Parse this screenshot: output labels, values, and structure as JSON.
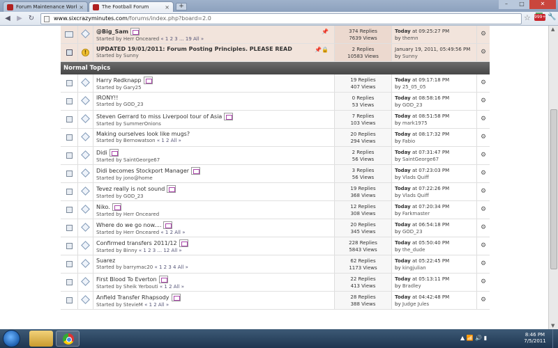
{
  "browser": {
    "tabs": [
      {
        "label": "Forum Maintenance Work",
        "active": false
      },
      {
        "label": "The Football Forum",
        "active": true
      }
    ],
    "new_tab_label": "+",
    "url_host": "www.sixcrazyminutes.com",
    "url_path": "/forums/index.php?board=2.0",
    "extension_badge": "999+"
  },
  "sticky_topics": [
    {
      "subject": "@Big_Sam",
      "started_by": "Herr Onceared",
      "pages": "« 1 2 3 ... 19  All »",
      "replies": "374 Replies",
      "views": "7639 Views",
      "last_time_prefix": "Today",
      "last_time": " at 09:25:27 PM",
      "last_by": "themn",
      "icon": "hot"
    },
    {
      "subject": "UPDATED 19/01/2011: Forum Posting Principles. PLEASE READ",
      "started_by": "Sunny",
      "pages": "",
      "replies": "2 Replies",
      "views": "10583 Views",
      "last_time_prefix": "",
      "last_time": "January 19, 2011, 05:49:56 PM",
      "last_by": "Sunny",
      "icon": "locked"
    }
  ],
  "section_title": "Normal Topics",
  "topics": [
    {
      "subject": "Harry Redknapp",
      "new": true,
      "started_by": "Gary25",
      "pages": "",
      "replies": "19 Replies",
      "views": "407 Views",
      "last_time": " at 09:17:18 PM",
      "last_by": "25_05_05"
    },
    {
      "subject": "IRONY!!",
      "new": false,
      "started_by": "GOD_23",
      "pages": "",
      "replies": "0 Replies",
      "views": "53 Views",
      "last_time": " at 08:58:16 PM",
      "last_by": "GOD_23"
    },
    {
      "subject": "Steven Gerrard to miss Liverpool tour of Asia",
      "new": true,
      "started_by": "SummerOnions",
      "pages": "",
      "replies": "7 Replies",
      "views": "103 Views",
      "last_time": " at 08:51:58 PM",
      "last_by": "mark1975"
    },
    {
      "subject": "Making ourselves look like mugs?",
      "new": false,
      "started_by": "Bernowatson",
      "pages": "« 1 2  All »",
      "replies": "20 Replies",
      "views": "294 Views",
      "last_time": " at 08:17:32 PM",
      "last_by": "Fabio"
    },
    {
      "subject": "Didi",
      "new": true,
      "started_by": "SaintGeorge67",
      "pages": "",
      "replies": "2 Replies",
      "views": "56 Views",
      "last_time": " at 07:31:47 PM",
      "last_by": "SaintGeorge67"
    },
    {
      "subject": "Didi becomes Stockport Manager",
      "new": true,
      "started_by": "jono@home",
      "pages": "",
      "replies": "3 Replies",
      "views": "56 Views",
      "last_time": " at 07:23:03 PM",
      "last_by": "Vlads Quiff"
    },
    {
      "subject": "Tevez really is not sound",
      "new": true,
      "started_by": "GOD_23",
      "pages": "",
      "replies": "19 Replies",
      "views": "368 Views",
      "last_time": " at 07:22:26 PM",
      "last_by": "Vlads Quiff"
    },
    {
      "subject": "Niko.",
      "new": true,
      "started_by": "Herr Onceared",
      "pages": "",
      "replies": "12 Replies",
      "views": "308 Views",
      "last_time": " at 07:20:34 PM",
      "last_by": "Farkmaster"
    },
    {
      "subject": "Where do we go now....",
      "new": true,
      "started_by": "Herr Onceared",
      "pages": "« 1 2  All »",
      "replies": "20 Replies",
      "views": "345 Views",
      "last_time": " at 06:54:18 PM",
      "last_by": "GOD_23"
    },
    {
      "subject": "Confirmed transfers 2011/12",
      "new": true,
      "started_by": "Binny",
      "pages": "« 1 2 3 ... 12  All »",
      "replies": "228 Replies",
      "views": "5843 Views",
      "last_time": " at 05:50:40 PM",
      "last_by": "the_dude"
    },
    {
      "subject": "Suarez",
      "new": false,
      "started_by": "barrymac20",
      "pages": "« 1 2 3 4  All »",
      "replies": "62 Replies",
      "views": "1173 Views",
      "last_time": " at 05:22:45 PM",
      "last_by": "kingjulian"
    },
    {
      "subject": "First Blood To Everton",
      "new": true,
      "started_by": "Sheik Yerbouti",
      "pages": "« 1 2  All »",
      "replies": "22 Replies",
      "views": "413 Views",
      "last_time": " at 05:13:11 PM",
      "last_by": "Bradley"
    },
    {
      "subject": "Anfield Transfer Rhapsody",
      "new": true,
      "started_by": "StevieM",
      "pages": "« 1 2  All »",
      "replies": "28 Replies",
      "views": "388 Views",
      "last_time": " at 04:42:48 PM",
      "last_by": "Judge Jules"
    }
  ],
  "labels": {
    "started_by": "Started by ",
    "by": "by ",
    "today": "Today"
  },
  "taskbar": {
    "time": "8:46 PM",
    "date": "7/5/2011"
  }
}
